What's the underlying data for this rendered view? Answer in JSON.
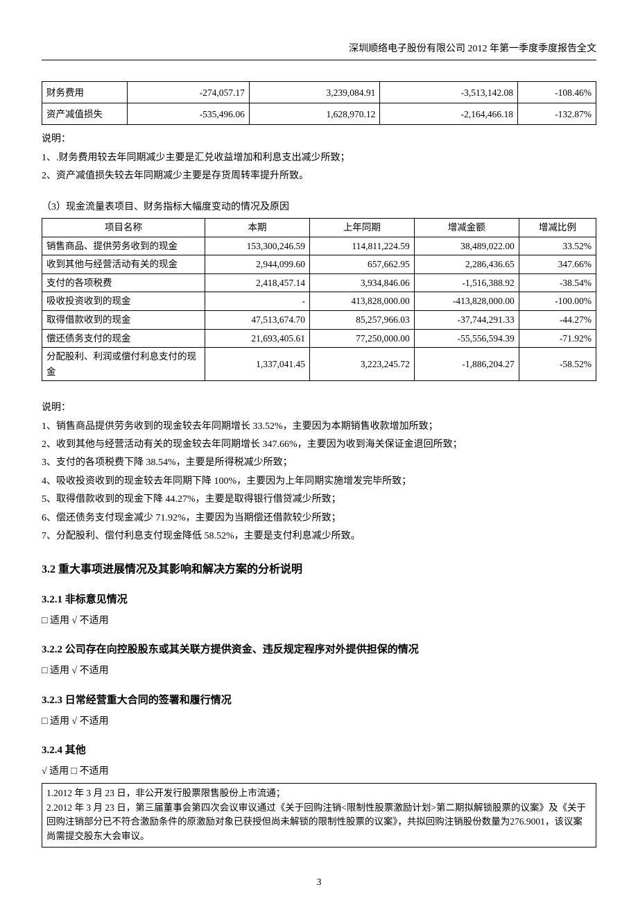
{
  "header": "深圳顺络电子股份有限公司 2012 年第一季度季度报告全文",
  "table1": {
    "rows": [
      {
        "label": "财务费用",
        "v1": "-274,057.17",
        "v2": "3,239,084.91",
        "v3": "-3,513,142.08",
        "pct": "-108.46%"
      },
      {
        "label": "资产减值损失",
        "v1": "-535,496.06",
        "v2": "1,628,970.12",
        "v3": "-2,164,466.18",
        "pct": "-132.87%"
      }
    ]
  },
  "explain1_title": "说明：",
  "explain1": [
    "1、.财务费用较去年同期减少主要是汇兑收益增加和利息支出减少所致；",
    "2、资产减值损失较去年同期减少主要是存货周转率提升所致。"
  ],
  "sub3_title": "（3）现金流量表项目、财务指标大幅度变动的情况及原因",
  "table2": {
    "headers": [
      "项目名称",
      "本期",
      "上年同期",
      "增减金额",
      "增减比例"
    ],
    "rows": [
      [
        "销售商品、提供劳务收到的现金",
        "153,300,246.59",
        "114,811,224.59",
        "38,489,022.00",
        "33.52%"
      ],
      [
        "收到其他与经营活动有关的现金",
        "2,944,099.60",
        "657,662.95",
        "2,286,436.65",
        "347.66%"
      ],
      [
        "支付的各项税费",
        "2,418,457.14",
        "3,934,846.06",
        "-1,516,388.92",
        "-38.54%"
      ],
      [
        "吸收投资收到的现金",
        "-",
        "413,828,000.00",
        "-413,828,000.00",
        "-100.00%"
      ],
      [
        "取得借款收到的现金",
        "47,513,674.70",
        "85,257,966.03",
        "-37,744,291.33",
        "-44.27%"
      ],
      [
        "偿还债务支付的现金",
        "21,693,405.61",
        "77,250,000.00",
        "-55,556,594.39",
        "-71.92%"
      ],
      [
        "分配股利、利润或偿付利息支付的现金",
        "1,337,041.45",
        "3,223,245.72",
        "-1,886,204.27",
        "-58.52%"
      ]
    ]
  },
  "explain2_title": "说明：",
  "explain2": [
    "1、销售商品提供劳务收到的现金较去年同期增长 33.52%，主要因为本期销售收款增加所致；",
    "2、收到其他与经营活动有关的现金较去年同期增长 347.66%，主要因为收到海关保证金退回所致；",
    "3、支付的各项税费下降 38.54%，主要是所得税减少所致；",
    "4、吸收投资收到的现金较去年同期下降 100%，主要因为上年同期实施增发完毕所致；",
    "5、取得借款收到的现金下降 44.27%，主要是取得银行借贷减少所致；",
    "6、偿还债务支付现金减少 71.92%，主要因为当期偿还借款较少所致；",
    "7、分配股利、偿付利息支付现金降低 58.52%，主要是支付利息减少所致。"
  ],
  "h32": "3.2 重大事项进展情况及其影响和解决方案的分析说明",
  "h321": "3.2.1 非标意见情况",
  "opt321": "□ 适用  √ 不适用",
  "h322": "3.2.2 公司存在向控股股东或其关联方提供资金、违反规定程序对外提供担保的情况",
  "opt322": "□ 适用  √ 不适用",
  "h323": "3.2.3 日常经营重大合同的签署和履行情况",
  "opt323": "□ 适用  √ 不适用",
  "h324": "3.2.4 其他",
  "opt324": "√ 适用  □ 不适用",
  "box_lines": [
    "1.2012 年 3 月 23 日，非公开发行股票限售股份上市流通；",
    "2.2012 年 3 月 23 日，第三届董事会第四次会议审议通过《关于回购注销<限制性股票激励计划>第二期拟解锁股票的议案》及《关于回购注销部分已不符合激励条件的原激励对象已获授但尚未解锁的限制性股票的议案》，共拟回购注销股份数量为276.9001，该议案尚需提交股东大会审议。"
  ],
  "page_number": "3"
}
